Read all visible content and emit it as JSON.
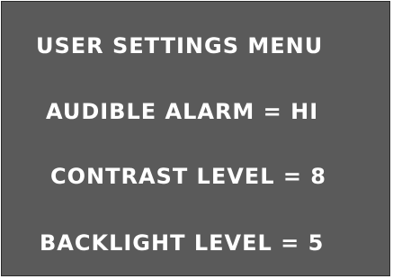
{
  "menu": {
    "title": "USER SETTINGS MENU",
    "items": [
      {
        "text": "AUDIBLE ALARM = HI"
      },
      {
        "text": "CONTRAST LEVEL = 8"
      },
      {
        "text": "BACKLIGHT LEVEL = 5"
      }
    ]
  },
  "colors": {
    "screen_background": "#5a5a5a",
    "text": "#ffffff"
  }
}
